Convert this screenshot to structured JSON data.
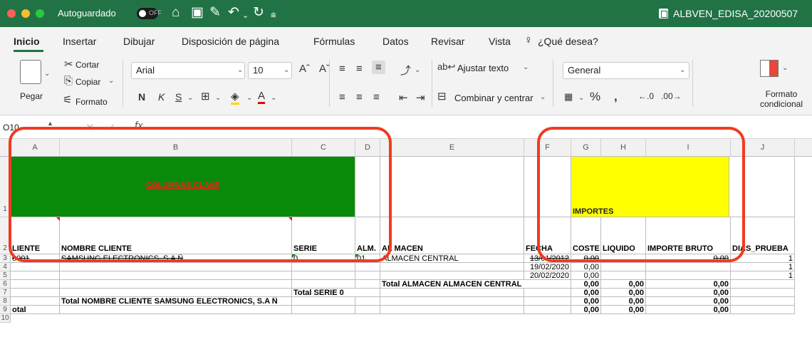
{
  "titlebar": {
    "autosave_label": "Autoguardado",
    "autosave_state": "OFF",
    "document_title": "ALBVEN_EDISA_20200507"
  },
  "tabs": [
    {
      "label": "Inicio",
      "active": true
    },
    {
      "label": "Insertar"
    },
    {
      "label": "Dibujar"
    },
    {
      "label": "Disposición de página"
    },
    {
      "label": "Fórmulas"
    },
    {
      "label": "Datos"
    },
    {
      "label": "Revisar"
    },
    {
      "label": "Vista"
    },
    {
      "label": "¿Qué desea?"
    }
  ],
  "ribbon": {
    "paste": "Pegar",
    "cut": "Cortar",
    "copy": "Copiar",
    "format_painter": "Formato",
    "font_name": "Arial",
    "font_size": "10",
    "bold": "N",
    "italic": "K",
    "underline": "S",
    "wrap_text": "Ajustar texto",
    "merge_center": "Combinar y centrar",
    "number_format": "General",
    "conditional_format": "Formato condicional"
  },
  "formula_bar": {
    "name_box": "O10",
    "fx": "fx",
    "value": ""
  },
  "grid": {
    "columns": [
      "A",
      "B",
      "C",
      "D",
      "E",
      "F",
      "G",
      "H",
      "I",
      "J"
    ],
    "rows": [
      "1",
      "2",
      "3",
      "4",
      "5",
      "6",
      "7",
      "8",
      "9",
      "10"
    ],
    "row1": {
      "clave": "COLUMNAS CLAVE",
      "importes": "IMPORTES"
    },
    "headers": {
      "a": "LIENTE",
      "b": "NOMBRE CLIENTE",
      "c": "SERIE",
      "d": "ALM.",
      "e": "AL MACEN",
      "f": "FECHA",
      "g": "COSTE",
      "h": "LIQUIDO",
      "i": "IMPORTE BRUTO",
      "j": "DIAS_PRUEBA"
    },
    "row3": {
      "a": "0001",
      "b": "SAMSUNG ELECTRONICS, S.A Ñ",
      "c": "0",
      "d": "01",
      "e": "ALMACEN CENTRAL",
      "f": "13/01/2012",
      "g": "0,00",
      "i": "0,00",
      "j": "1"
    },
    "row4": {
      "f": "19/02/2020",
      "g": "0,00",
      "j": "1"
    },
    "row5": {
      "f": "20/02/2020",
      "g": "0,00",
      "j": "1"
    },
    "row6": {
      "e": "Total ALMACEN ALMACEN CENTRAL",
      "g": "0,00",
      "h": "0,00",
      "i": "0,00"
    },
    "row7": {
      "c": "Total SERIE 0",
      "g": "0,00",
      "h": "0,00",
      "i": "0,00"
    },
    "row8": {
      "b": "Total NOMBRE CLIENTE SAMSUNG ELECTRONICS, S.A Ñ",
      "g": "0,00",
      "h": "0,00",
      "i": "0,00"
    },
    "row9": {
      "a": "otal",
      "g": "0,00",
      "h": "0,00",
      "i": "0,00"
    }
  },
  "colors": {
    "excel_green": "#217346",
    "key_fill": "#0a8a0a",
    "amount_fill": "#ffff00",
    "callout": "#f23a1e"
  }
}
